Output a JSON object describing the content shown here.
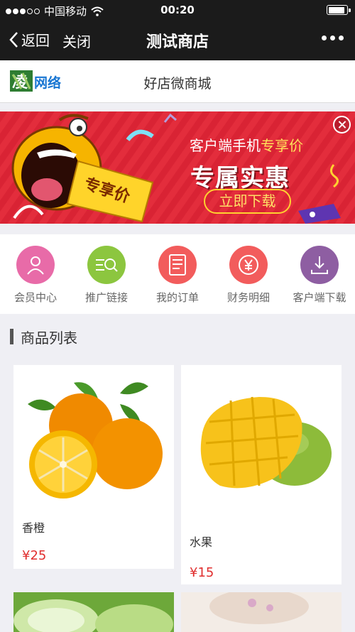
{
  "status_bar": {
    "carrier": "中国移动",
    "time": "00:20"
  },
  "nav": {
    "back_label": "返回",
    "close_label": "关闭",
    "title": "测试商店"
  },
  "shop": {
    "logo_text": "凌夕网络",
    "name": "好店微商城"
  },
  "banner": {
    "badge_text": "专享价",
    "line1_prefix": "客户端手机",
    "line1_highlight": "专享价",
    "line2": "专属实惠",
    "download_label": "立即下载"
  },
  "menu": [
    {
      "label": "会员中心",
      "icon": "user-icon",
      "color": "#e86ba8"
    },
    {
      "label": "推广链接",
      "icon": "search-list-icon",
      "color": "#8cc63f"
    },
    {
      "label": "我的订单",
      "icon": "order-icon",
      "color": "#f25c5c"
    },
    {
      "label": "财务明细",
      "icon": "yen-icon",
      "color": "#f25c5c"
    },
    {
      "label": "客户端下载",
      "icon": "download-icon",
      "color": "#8e5ea2"
    }
  ],
  "section": {
    "title": "商品列表"
  },
  "products": [
    {
      "name": "香橙",
      "price": "¥25"
    },
    {
      "name": "水果",
      "price": "¥15"
    }
  ],
  "colors": {
    "nav_bg": "#1b1b1b",
    "banner_bg": "#e32d3c",
    "price": "#e02e2e",
    "page_bg": "#efeff4"
  }
}
